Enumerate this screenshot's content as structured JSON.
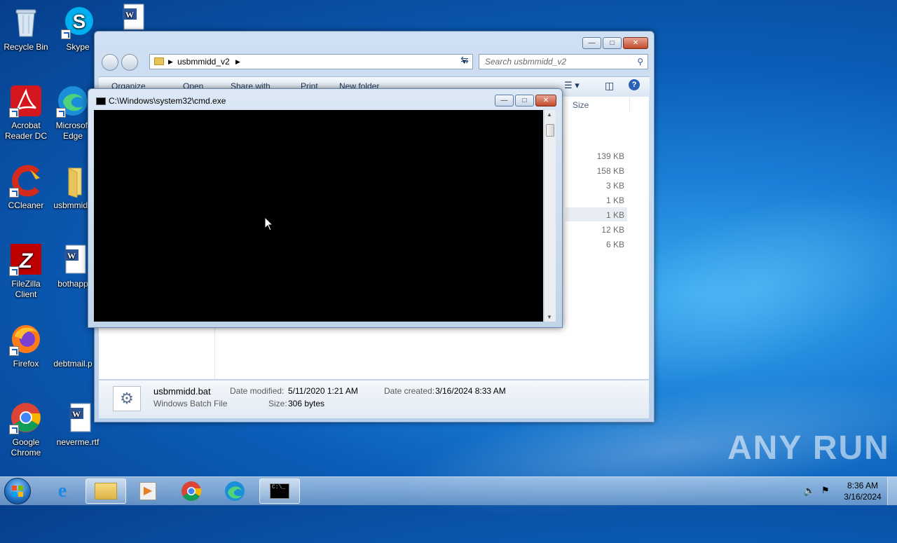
{
  "desktop": {
    "icons": [
      {
        "label": "Recycle Bin"
      },
      {
        "label": "Skype"
      },
      {
        "label": "Acrobat Reader DC"
      },
      {
        "label": "Microsoft Edge"
      },
      {
        "label": "CCleaner"
      },
      {
        "label": "usbmmidd"
      },
      {
        "label": "FileZilla Client"
      },
      {
        "label": "bothapp"
      },
      {
        "label": "Firefox"
      },
      {
        "label": "debtmail.p"
      },
      {
        "label": "Google Chrome"
      },
      {
        "label": "neverme.rtf"
      }
    ]
  },
  "explorer": {
    "breadcrumb": "usbmmidd_v2",
    "search_placeholder": "Search usbmmidd_v2",
    "toolbar": {
      "organize": "Organize",
      "open": "Open",
      "share_with": "Share with",
      "print": "Print",
      "new_folder": "New folder"
    },
    "column_size": "Size",
    "sizes": [
      "139 KB",
      "158 KB",
      "3 KB",
      "1 KB",
      "1 KB",
      "12 KB",
      "6 KB"
    ],
    "details": {
      "filename": "usbmmidd.bat",
      "filetype": "Windows Batch File",
      "date_modified_label": "Date modified:",
      "date_modified": "5/11/2020 1:21 AM",
      "size_label": "Size:",
      "size": "306 bytes",
      "date_created_label": "Date created:",
      "date_created": "3/16/2024 8:33 AM"
    }
  },
  "cmd": {
    "title": "C:\\Windows\\system32\\cmd.exe"
  },
  "taskbar": {
    "time": "8:36 AM",
    "date": "3/16/2024"
  },
  "watermark": "ANY RUN",
  "colors": {
    "desktop": "#0b5db8",
    "console_bg": "#000000",
    "window_frame": "#b9d1ec"
  }
}
